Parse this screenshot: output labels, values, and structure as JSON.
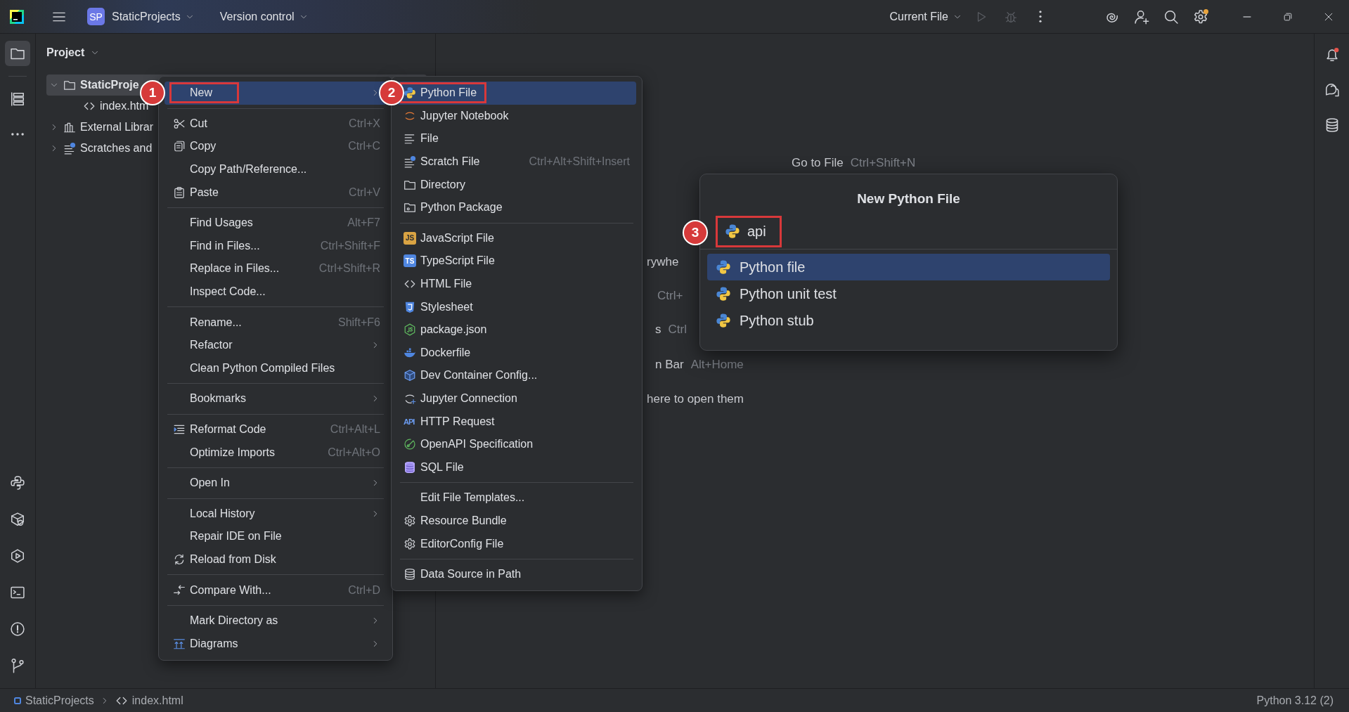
{
  "title_bar": {
    "project_initials": "SP",
    "project_name": "StaticProjects",
    "vcs": "Version control",
    "run_config": "Current File",
    "run_disabled": true,
    "debug_disabled": true,
    "settings_badge": true
  },
  "tool_strip": {
    "top": [
      {
        "kind": "folder",
        "selected": true
      },
      {
        "kind": "structure",
        "selected": false
      },
      {
        "kind": "more",
        "selected": false
      }
    ],
    "bottom": [
      {
        "kind": "python",
        "selected": false
      },
      {
        "kind": "packages",
        "selected": false
      },
      {
        "kind": "services",
        "selected": false
      },
      {
        "kind": "terminal",
        "selected": false
      },
      {
        "kind": "problems",
        "selected": false
      },
      {
        "kind": "git",
        "selected": false
      }
    ]
  },
  "right_strip": [
    {
      "kind": "bell"
    },
    {
      "kind": "ai-chat"
    },
    {
      "kind": "database"
    }
  ],
  "project_panel": {
    "title": "Project",
    "tree": [
      {
        "label": "StaticProje",
        "kind": "folder",
        "expanded": true,
        "selected": true,
        "children": [
          {
            "label": "index.htm",
            "kind": "html",
            "selected": false
          }
        ]
      },
      {
        "label": "External Librar",
        "kind": "library",
        "expanded": false,
        "selected": false
      },
      {
        "label": "Scratches and",
        "kind": "scratch",
        "expanded": false,
        "selected": false
      }
    ]
  },
  "editor_hints": [
    {
      "text": "Go to File",
      "shortcut": "Ctrl+Shift+N"
    },
    {
      "text": "rywhe"
    },
    {
      "shortcut": "Ctrl+"
    },
    {
      "text": "s",
      "shortcut": "Ctrl"
    },
    {
      "text": "n Bar",
      "shortcut": "Alt+Home"
    },
    {
      "text": "here to open them"
    }
  ],
  "context_menu": {
    "groups": [
      {
        "items": [
          {
            "label": "New",
            "selected": true,
            "submenu": true,
            "step": "1"
          }
        ]
      },
      {
        "items": [
          {
            "label": "Cut",
            "kind": "scissors",
            "shortcut": "Ctrl+X",
            "selected": false,
            "submenu": false
          },
          {
            "label": "Copy",
            "kind": "copy",
            "shortcut": "Ctrl+C",
            "selected": false,
            "submenu": false
          },
          {
            "label": "Copy Path/Reference...",
            "selected": false,
            "submenu": false
          },
          {
            "label": "Paste",
            "kind": "paste",
            "shortcut": "Ctrl+V",
            "selected": false,
            "submenu": false
          }
        ]
      },
      {
        "items": [
          {
            "label": "Find Usages",
            "shortcut": "Alt+F7",
            "selected": false,
            "submenu": false
          },
          {
            "label": "Find in Files...",
            "shortcut": "Ctrl+Shift+F",
            "selected": false,
            "submenu": false
          },
          {
            "label": "Replace in Files...",
            "shortcut": "Ctrl+Shift+R",
            "selected": false,
            "submenu": false
          },
          {
            "label": "Inspect Code...",
            "selected": false,
            "submenu": false
          }
        ]
      },
      {
        "items": [
          {
            "label": "Rename...",
            "shortcut": "Shift+F6",
            "selected": false,
            "submenu": false
          },
          {
            "label": "Refactor",
            "selected": false,
            "submenu": true
          },
          {
            "label": "Clean Python Compiled Files",
            "selected": false,
            "submenu": false
          }
        ]
      },
      {
        "items": [
          {
            "label": "Bookmarks",
            "selected": false,
            "submenu": true
          }
        ]
      },
      {
        "items": [
          {
            "label": "Reformat Code",
            "kind": "reformat",
            "shortcut": "Ctrl+Alt+L",
            "selected": false,
            "submenu": false
          },
          {
            "label": "Optimize Imports",
            "shortcut": "Ctrl+Alt+O",
            "selected": false,
            "submenu": false
          }
        ]
      },
      {
        "items": [
          {
            "label": "Open In",
            "selected": false,
            "submenu": true
          }
        ]
      },
      {
        "items": [
          {
            "label": "Local History",
            "selected": false,
            "submenu": true
          },
          {
            "label": "Repair IDE on File",
            "selected": false,
            "submenu": false
          },
          {
            "label": "Reload from Disk",
            "kind": "reload",
            "selected": false,
            "submenu": false
          }
        ]
      },
      {
        "items": [
          {
            "label": "Compare With...",
            "kind": "compare",
            "shortcut": "Ctrl+D",
            "selected": false,
            "submenu": false
          }
        ]
      },
      {
        "items": [
          {
            "label": "Mark Directory as",
            "selected": false,
            "submenu": true
          },
          {
            "label": "Diagrams",
            "kind": "diagrams",
            "selected": false,
            "submenu": true
          }
        ]
      }
    ]
  },
  "new_submenu": {
    "groups": [
      {
        "items": [
          {
            "label": "Python File",
            "kind": "python",
            "selected": true,
            "step": "2"
          },
          {
            "label": "Jupyter Notebook",
            "kind": "jupyter",
            "selected": false
          },
          {
            "label": "File",
            "kind": "lines",
            "selected": false
          },
          {
            "label": "Scratch File",
            "kind": "scratch",
            "shortcut": "Ctrl+Alt+Shift+Insert",
            "selected": false
          },
          {
            "label": "Directory",
            "kind": "folder",
            "selected": false
          },
          {
            "label": "Python Package",
            "kind": "package",
            "selected": false
          }
        ]
      },
      {
        "items": [
          {
            "label": "JavaScript File",
            "kind": "js",
            "icon_text": "JS",
            "selected": false
          },
          {
            "label": "TypeScript File",
            "kind": "ts",
            "icon_text": "TS",
            "selected": false
          },
          {
            "label": "HTML File",
            "kind": "html",
            "selected": false
          },
          {
            "label": "Stylesheet",
            "kind": "css",
            "selected": false
          },
          {
            "label": "package.json",
            "kind": "node",
            "selected": false
          },
          {
            "label": "Dockerfile",
            "kind": "docker",
            "selected": false
          },
          {
            "label": "Dev Container Config...",
            "kind": "cube",
            "selected": false
          },
          {
            "label": "Jupyter Connection",
            "kind": "jupyter-conn",
            "selected": false
          },
          {
            "label": "HTTP Request",
            "kind": "api",
            "icon_text": "API",
            "selected": false
          },
          {
            "label": "OpenAPI Specification",
            "kind": "openapi",
            "selected": false
          },
          {
            "label": "SQL File",
            "kind": "sql",
            "selected": false
          }
        ]
      },
      {
        "items": [
          {
            "label": "Edit File Templates...",
            "selected": false
          },
          {
            "label": "Resource Bundle",
            "kind": "gear",
            "selected": false
          },
          {
            "label": "EditorConfig File",
            "kind": "gear",
            "selected": false
          }
        ]
      },
      {
        "items": [
          {
            "label": "Data Source in Path",
            "kind": "db",
            "selected": false
          }
        ]
      }
    ]
  },
  "new_file_popup": {
    "title": "New Python File",
    "value": "api",
    "step": "3",
    "options": [
      {
        "label": "Python file",
        "selected": true
      },
      {
        "label": "Python unit test",
        "selected": false
      },
      {
        "label": "Python stub",
        "selected": false
      }
    ]
  },
  "status_bar": {
    "breadcrumbs": [
      {
        "label": "StaticProjects",
        "kind": "project"
      },
      {
        "label": "index.html",
        "kind": "html"
      }
    ],
    "interpreter": "Python 3.12 (2)"
  }
}
